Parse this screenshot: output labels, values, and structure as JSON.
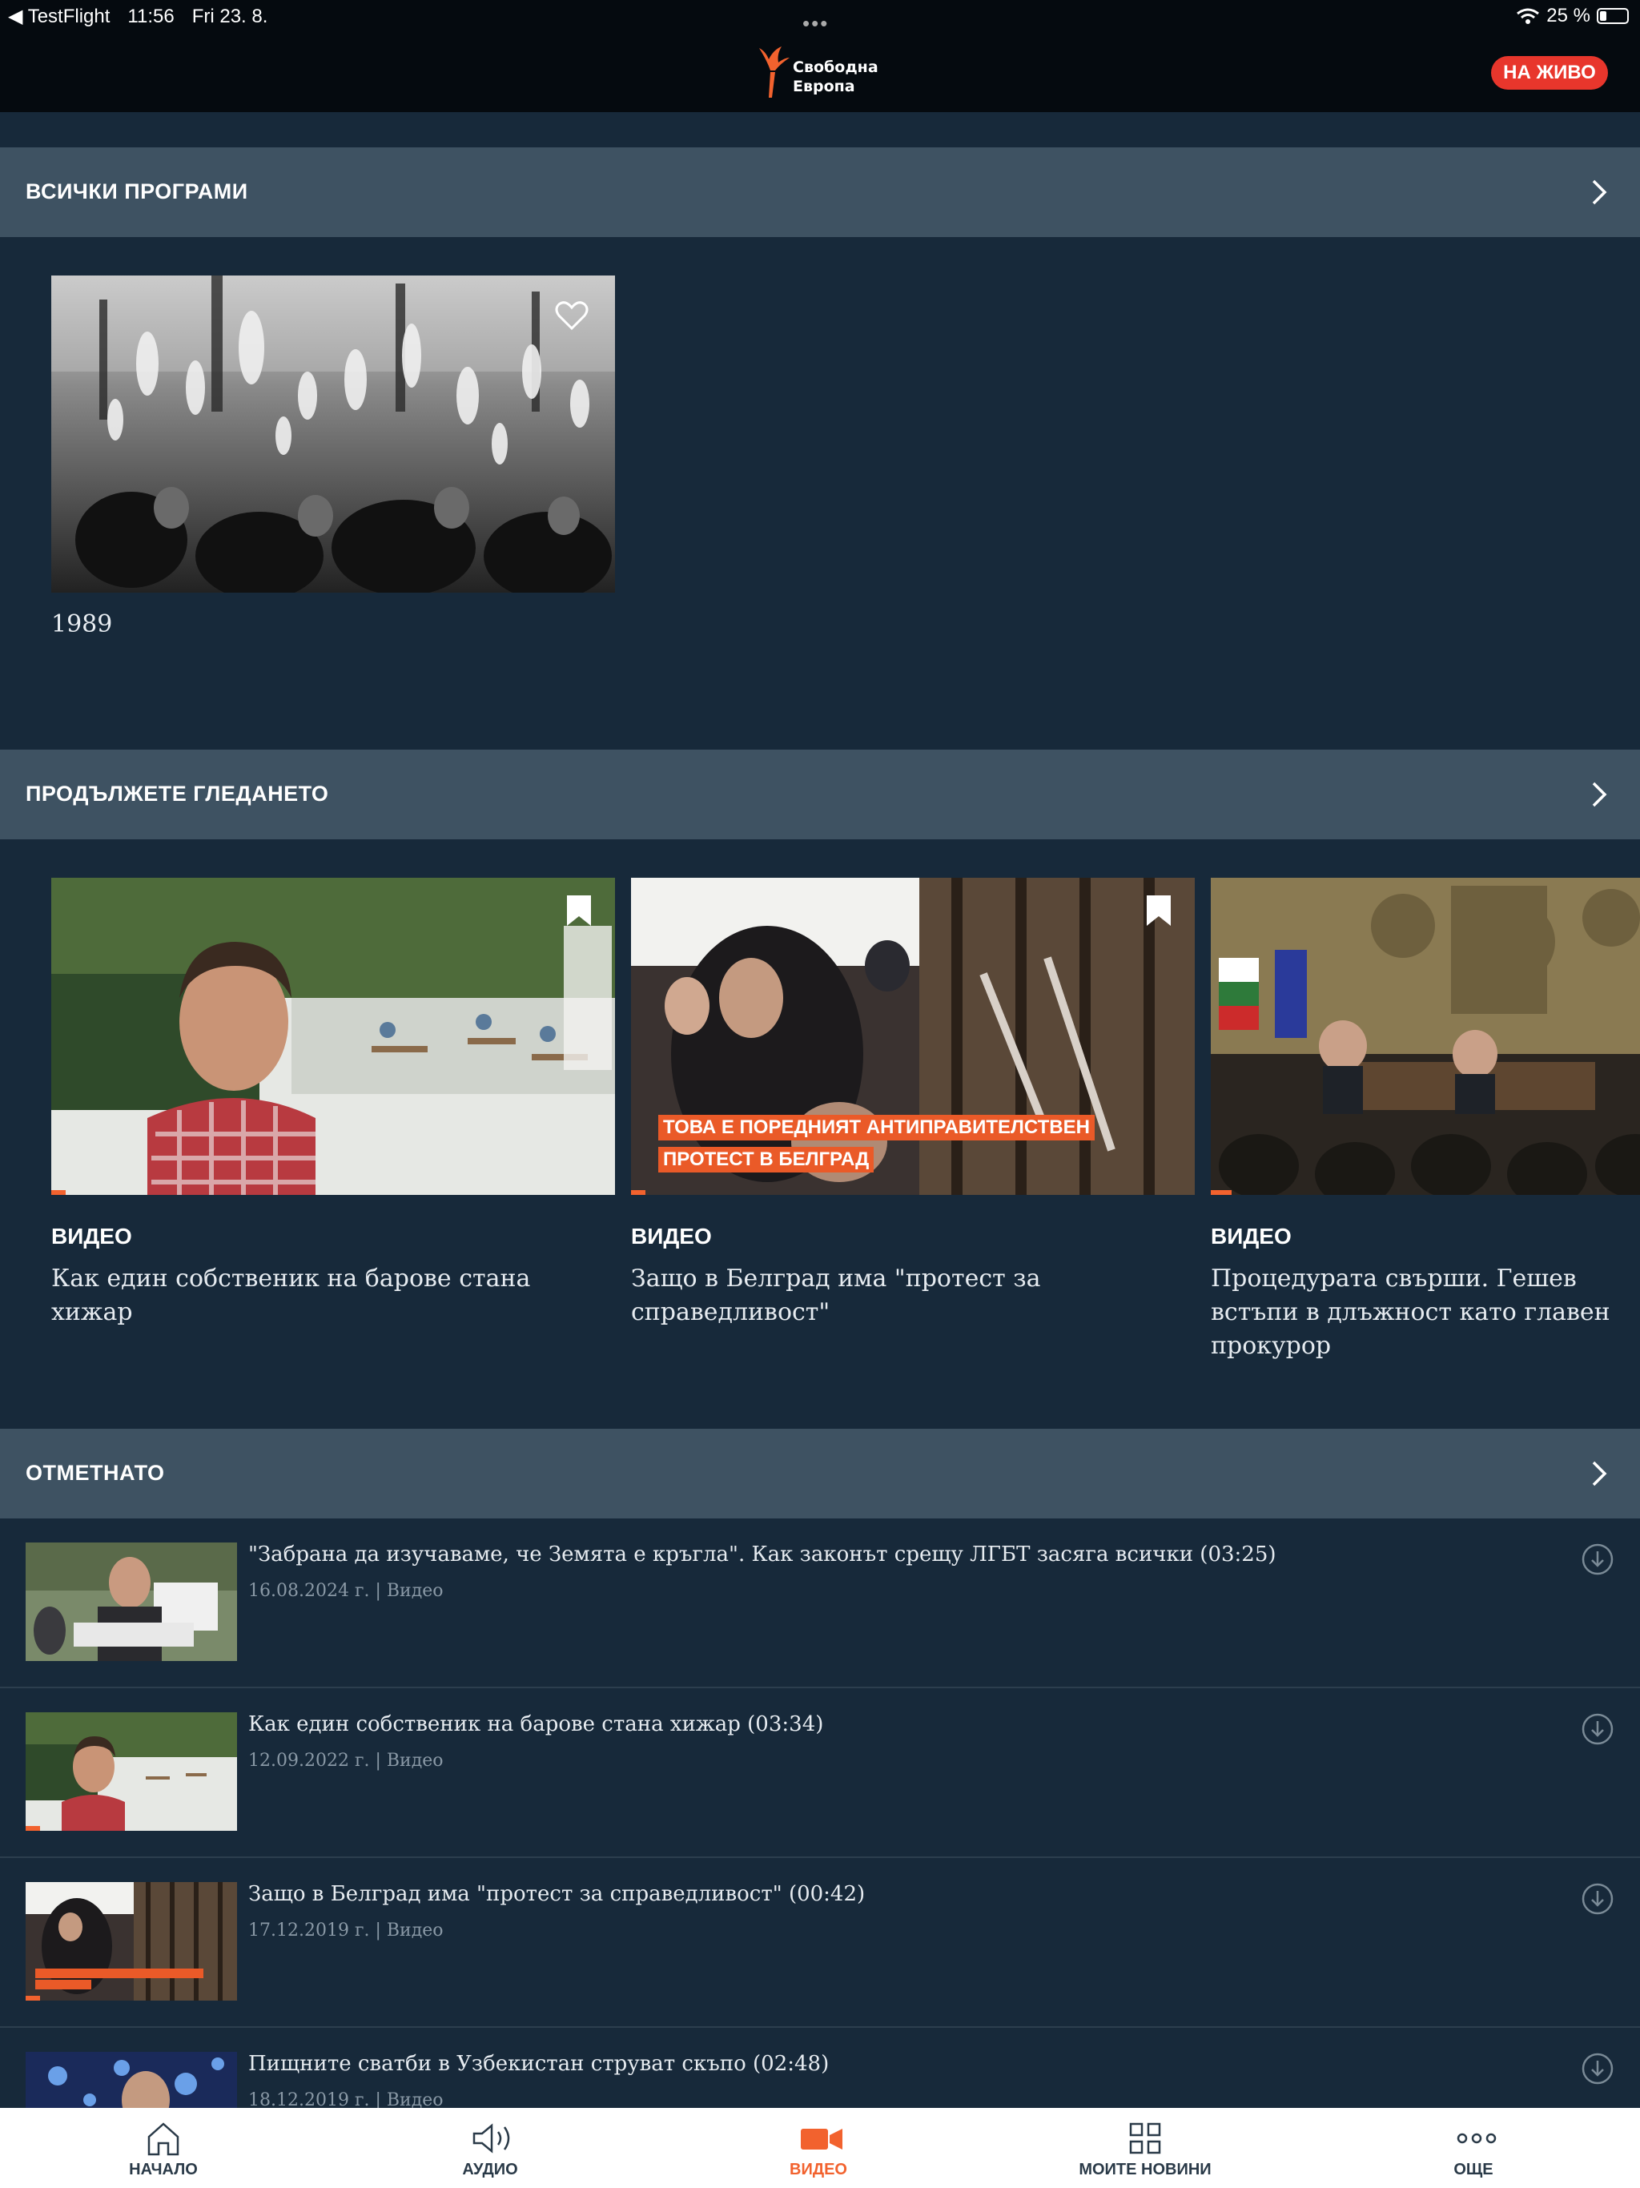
{
  "status_bar": {
    "app": "TestFlight",
    "time": "11:56",
    "date": "Fri 23. 8.",
    "battery": "25 %"
  },
  "header": {
    "logo_line1": "Свободна",
    "logo_line2": "Европа",
    "live_button": "НА ЖИВО",
    "accent_color": "#f2622e",
    "live_color": "#e8362c"
  },
  "sections": {
    "programs": {
      "title": "ВСИЧКИ ПРОГРАМИ",
      "items": [
        {
          "title": "1989",
          "icon": "heart-outline-icon"
        }
      ]
    },
    "continue_watching": {
      "title": "ПРОДЪЛЖЕТЕ ГЛЕДАНЕТО",
      "items": [
        {
          "kind": "ВИДЕО",
          "title": "Как един собственик на барове стана хижар",
          "progress": 0.02
        },
        {
          "kind": "ВИДЕО",
          "title": "Защо в Белград има \"протест за справедливост\"",
          "caption_line1": "ТОВА Е ПОРЕДНИЯТ АНТИПРАВИТЕЛСТВЕН",
          "caption_line2": "ПРОТЕСТ В БЕЛГРАД",
          "progress": 0.02
        },
        {
          "kind": "ВИДЕО",
          "title": "Процедурата свърши. Гешев встъпи в длъжност като главен прокурор",
          "progress": 0.02
        }
      ]
    },
    "bookmarked": {
      "title": "ОТМЕТНАТО",
      "items": [
        {
          "title": "\"Забрана да изучаваме, че Земята е кръгла\". Как законът срещу ЛГБТ засяга всички (03:25)",
          "date": "16.08.2024 г.",
          "category": "Видео"
        },
        {
          "title": "Как един собственик на барове стана хижар (03:34)",
          "date": "12.09.2022 г.",
          "category": "Видео"
        },
        {
          "title": "Защо в Белград има \"протест за справедливост\" (00:42)",
          "date": "17.12.2019 г.",
          "category": "Видео"
        },
        {
          "title": "Пищните сватби в Узбекистан струват скъпо (02:48)",
          "date": "18.12.2019 г.",
          "category": "Видео"
        }
      ]
    }
  },
  "tabs": [
    {
      "label": "НАЧАЛО",
      "icon": "home-icon"
    },
    {
      "label": "АУДИО",
      "icon": "speaker-icon"
    },
    {
      "label": "ВИДЕО",
      "icon": "video-camera-icon",
      "active": true
    },
    {
      "label": "МОИТЕ НОВИНИ",
      "icon": "grid-icon"
    },
    {
      "label": "ОЩЕ",
      "icon": "more-dots-icon"
    }
  ]
}
